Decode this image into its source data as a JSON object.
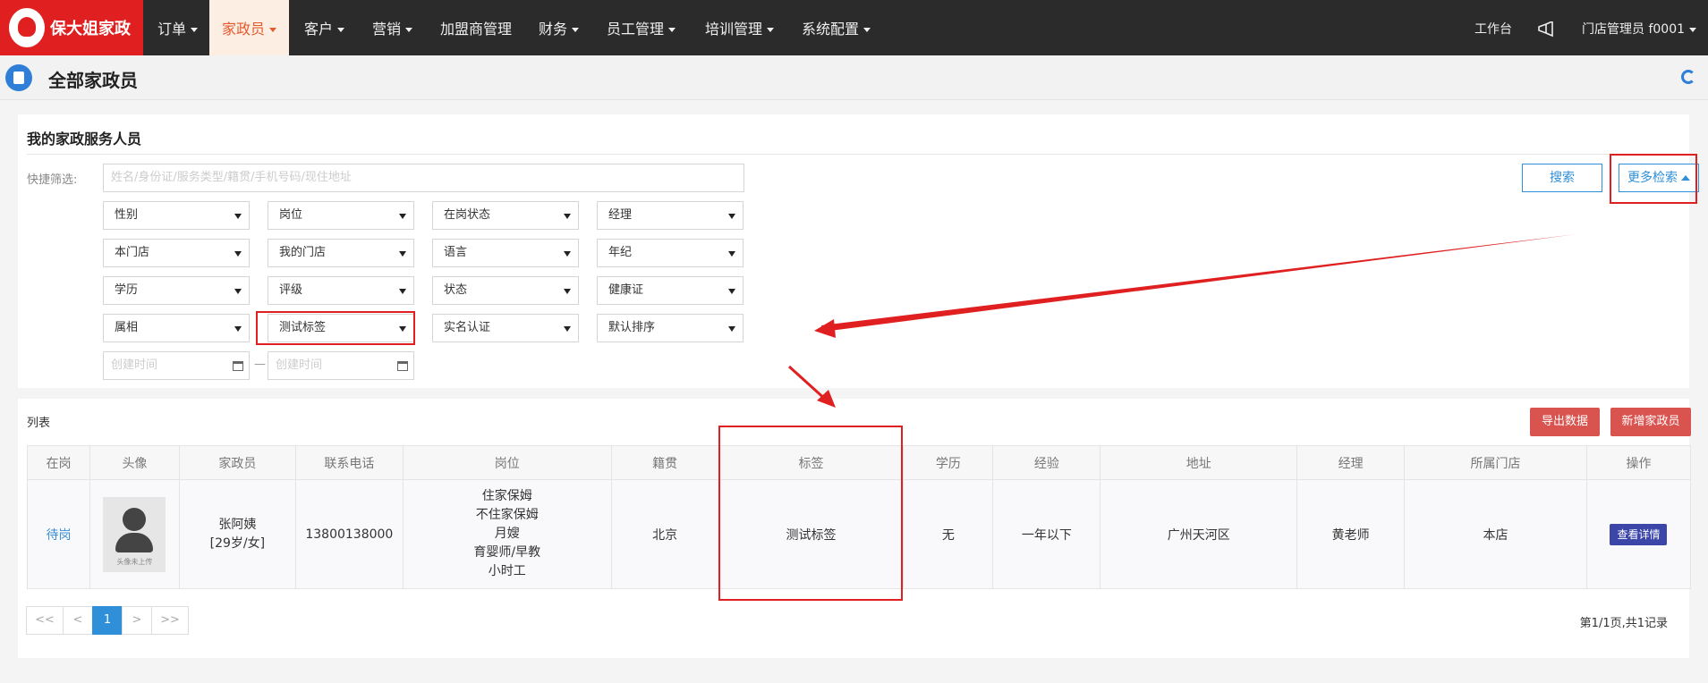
{
  "nav": {
    "logo": "保大姐家政",
    "items": [
      "订单",
      "家政员",
      "客户",
      "营销",
      "加盟商管理",
      "财务",
      "员工管理",
      "培训管理",
      "系统配置"
    ],
    "workbench": "工作台",
    "user": "门店管理员  f0001"
  },
  "page": {
    "title": "全部家政员"
  },
  "filter": {
    "title": "我的家政服务人员",
    "quick_label": "快捷筛选:",
    "quick_placeholder": "姓名/身份证/服务类型/籍贯/手机号码/现住地址",
    "search_button": "搜索",
    "more_button": "更多检索",
    "selects": [
      [
        "性别",
        "岗位",
        "在岗状态",
        "经理"
      ],
      [
        "本门店",
        "我的门店",
        "语言",
        "年纪"
      ],
      [
        "学历",
        "评级",
        "状态",
        "健康证"
      ],
      [
        "属相",
        "测试标签",
        "实名认证",
        "默认排序"
      ]
    ],
    "date_start_placeholder": "创建时间",
    "date_end_placeholder": "创建时间",
    "date_separator": "—"
  },
  "list": {
    "title": "列表",
    "export_button": "导出数据",
    "add_button": "新增家政员",
    "columns": [
      "在岗",
      "头像",
      "家政员",
      "联系电话",
      "岗位",
      "籍贯",
      "标签",
      "学历",
      "经验",
      "地址",
      "经理",
      "所属门店",
      "操作"
    ],
    "rows": [
      {
        "status": "待岗",
        "avatar_text": "头像未上传",
        "name": "张阿姨",
        "age_gender": "[29岁/女]",
        "phone": "13800138000",
        "roles": [
          "住家保姆",
          "不住家保姆",
          "月嫂",
          "育婴师/早教",
          "小时工"
        ],
        "origin": "北京",
        "tag": "测试标签",
        "education": "无",
        "experience": "一年以下",
        "address": "广州天河区",
        "manager": "黄老师",
        "store": "本店",
        "action": "查看详情"
      }
    ],
    "pager": [
      "<<",
      "<",
      "1",
      ">",
      ">>"
    ],
    "page_info": "第1/1页,共1记录"
  },
  "colors": {
    "brand_red": "#e02020",
    "accent_blue": "#2f8fd8",
    "danger_button": "#d9534f",
    "annotation_red": "#e02020"
  }
}
